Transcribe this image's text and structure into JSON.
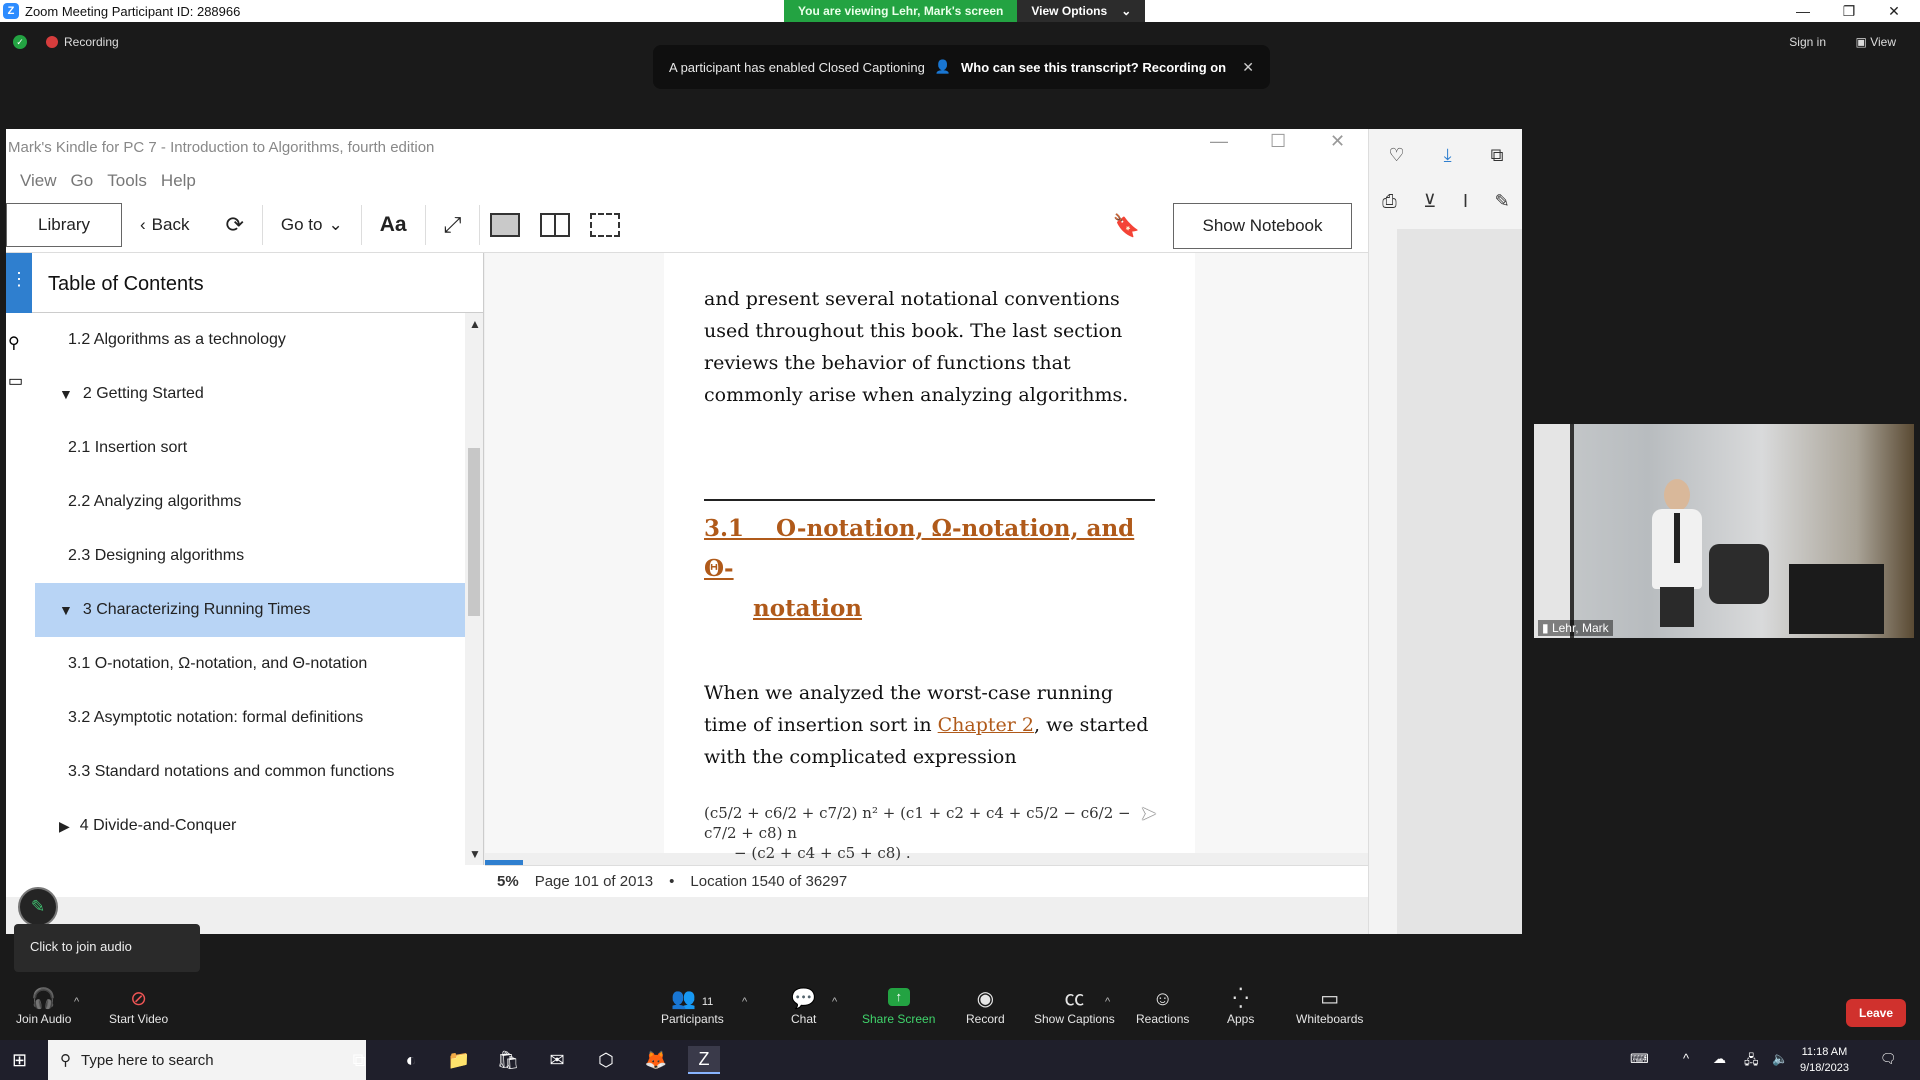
{
  "zoom": {
    "window_title": "Zoom Meeting Participant ID: 288966",
    "viewing_banner": "You are viewing Lehr, Mark's screen",
    "view_options": "View Options",
    "recording_label": "Recording",
    "sign_in": "Sign in",
    "view_label": "View",
    "cc_banner": {
      "message": "A participant has enabled Closed Captioning",
      "who_label": "Who can see this transcript? Recording on"
    }
  },
  "kindle": {
    "title": "Mark's Kindle for PC 7 - Introduction to Algorithms, fourth edition",
    "menu": [
      "View",
      "Go",
      "Tools",
      "Help"
    ],
    "toolbar": {
      "library": "Library",
      "back": "Back",
      "goto": "Go to",
      "font": "Aa",
      "show_notebook": "Show Notebook"
    },
    "toc": {
      "heading": "Table of Contents",
      "items": [
        {
          "label": "1.2 Algorithms as a technology",
          "indent": 2,
          "marker": ""
        },
        {
          "label": "2 Getting Started",
          "indent": 1,
          "marker": "▼"
        },
        {
          "label": "2.1 Insertion sort",
          "indent": 2,
          "marker": ""
        },
        {
          "label": "2.2 Analyzing algorithms",
          "indent": 2,
          "marker": ""
        },
        {
          "label": "2.3 Designing algorithms",
          "indent": 2,
          "marker": ""
        },
        {
          "label": "3 Characterizing Running Times",
          "indent": 1,
          "marker": "▼",
          "selected": true
        },
        {
          "label": "3.1 O-notation, Ω-notation, and Θ-notation",
          "indent": 2,
          "marker": ""
        },
        {
          "label": "3.2 Asymptotic notation: formal definitions",
          "indent": 2,
          "marker": ""
        },
        {
          "label": "3.3 Standard notations and common functions",
          "indent": 2,
          "marker": ""
        },
        {
          "label": "4 Divide-and-Conquer",
          "indent": 1,
          "marker": "▶"
        }
      ]
    },
    "page": {
      "para1": "and present several notational conventions used throughout this book. The last section reviews the behavior of functions that commonly arise when analyzing algorithms.",
      "section_num": "3.1",
      "section_title_1": "O-notation, Ω-notation, and Θ-",
      "section_title_2": "notation",
      "para2_a": "When we analyzed the worst-case running time of insertion sort in ",
      "para2_link": "Chapter 2",
      "para2_b": ", we started with the complicated expression",
      "equation_1": "(c5/2 + c6/2 + c7/2) n² + (c1 + c2 + c4 + c5/2 − c6/2 − c7/2 + c8) n",
      "equation_2": "− (c2 + c4 + c5 + c8) ."
    },
    "status": {
      "percent": "5%",
      "page": "Page 101 of 2013",
      "separator": "•",
      "location": "Location 1540 of 36297"
    },
    "progress_fraction": 0.05
  },
  "video": {
    "participant_name": "Lehr, Mark"
  },
  "join_audio_tip": "Click to join audio",
  "zoom_toolbar": {
    "join_audio": "Join Audio",
    "start_video": "Start Video",
    "participants": "Participants",
    "participants_count": "11",
    "chat": "Chat",
    "share_screen": "Share Screen",
    "record": "Record",
    "show_captions": "Show Captions",
    "reactions": "Reactions",
    "apps": "Apps",
    "whiteboards": "Whiteboards",
    "leave": "Leave"
  },
  "taskbar": {
    "search_placeholder": "Type here to search",
    "time": "11:18 AM",
    "date": "9/18/2023"
  },
  "colors": {
    "zoom_green": "#23a342",
    "kindle_blue": "#2f7fcf",
    "toc_selected": "#b8d4f5",
    "section_orange": "#b05a1a",
    "leave_red": "#d0312d"
  }
}
